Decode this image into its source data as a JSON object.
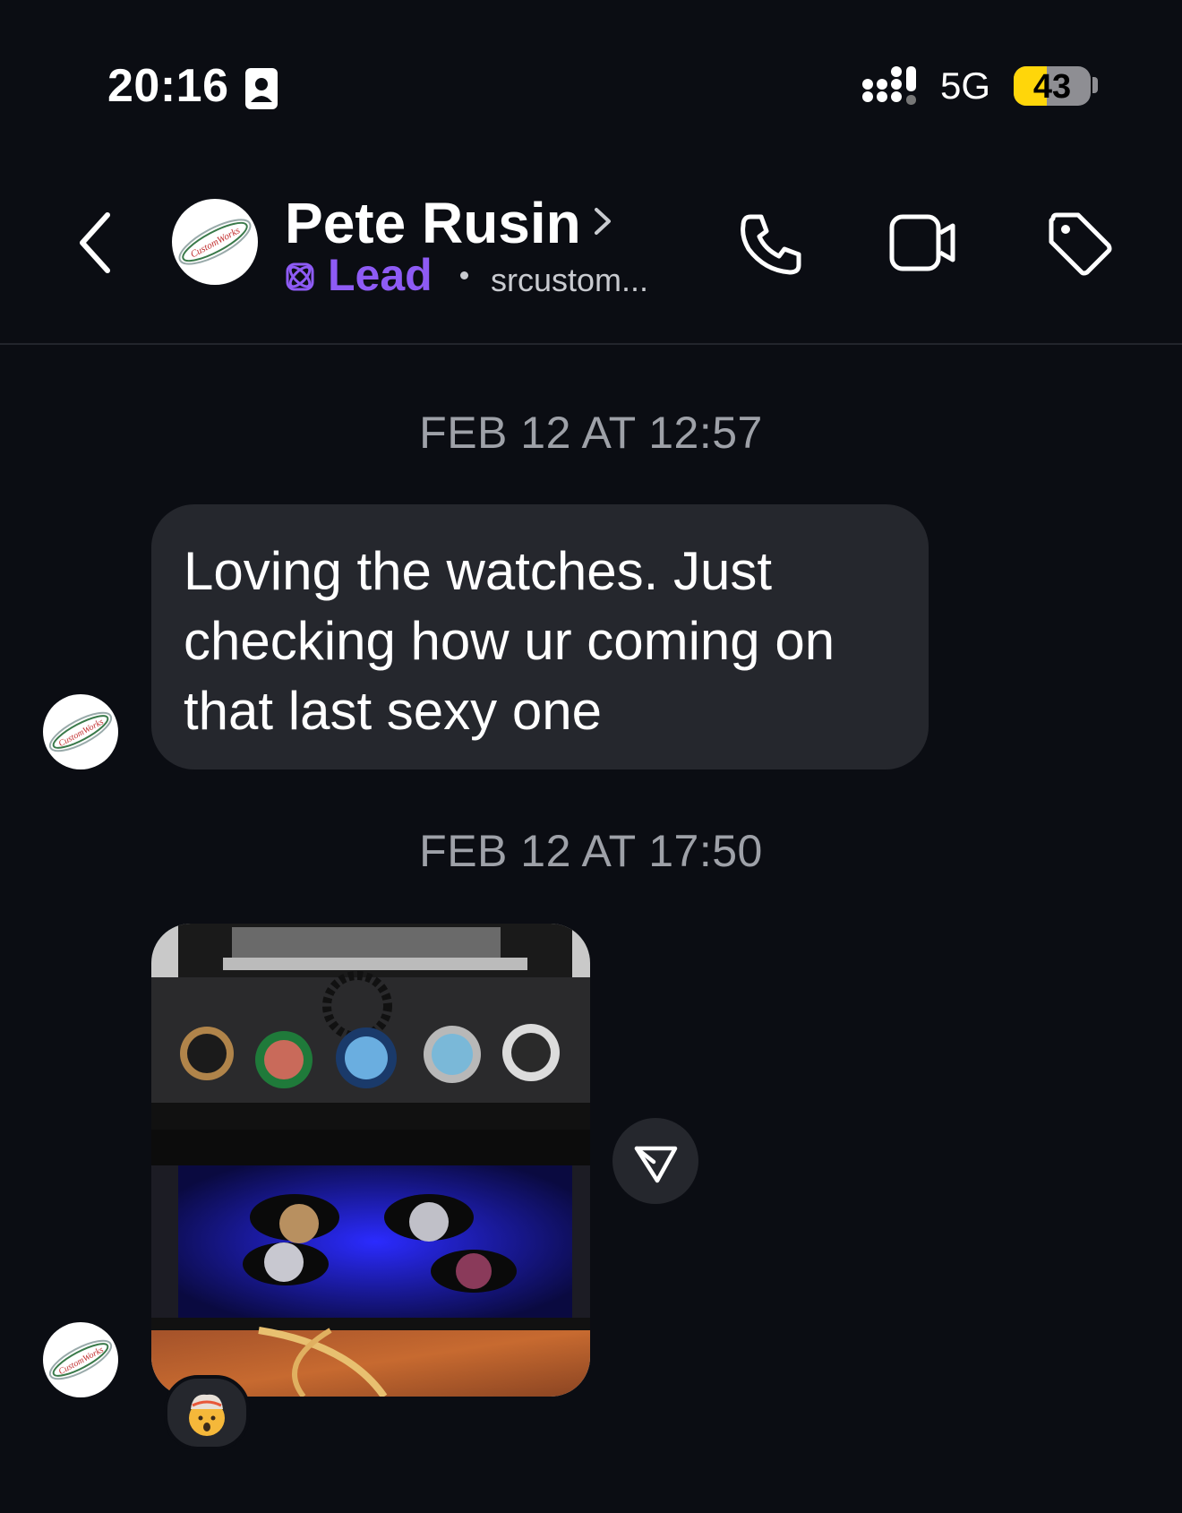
{
  "status_bar": {
    "time": "20:16",
    "network": "5G",
    "battery": "43",
    "battery_level": 0.43
  },
  "header": {
    "contact_name": "Pete Rusin",
    "lead_label": "Lead",
    "username": "srcustom..."
  },
  "avatar_logo_text": "CustomWorks",
  "messages": [
    {
      "timestamp": "FEB 12 AT 12:57",
      "text": "Loving the watches. Just\nchecking how ur coming on\nthat last sexy one"
    },
    {
      "timestamp": "FEB 12 AT 17:50",
      "type": "photo",
      "reaction": "🤯"
    }
  ],
  "colors": {
    "background": "#0b0d13",
    "bubble": "#25272d",
    "lead_accent": "#8e5bf5",
    "timestamp": "#9ea1a8",
    "battery_fill": "#ffd60a"
  },
  "icons": [
    "id-card-icon",
    "signal-icon",
    "back-arrow-icon",
    "chevron-right-icon",
    "lead-icon",
    "phone-icon",
    "video-camera-icon",
    "tag-icon",
    "send-arrow-icon"
  ]
}
